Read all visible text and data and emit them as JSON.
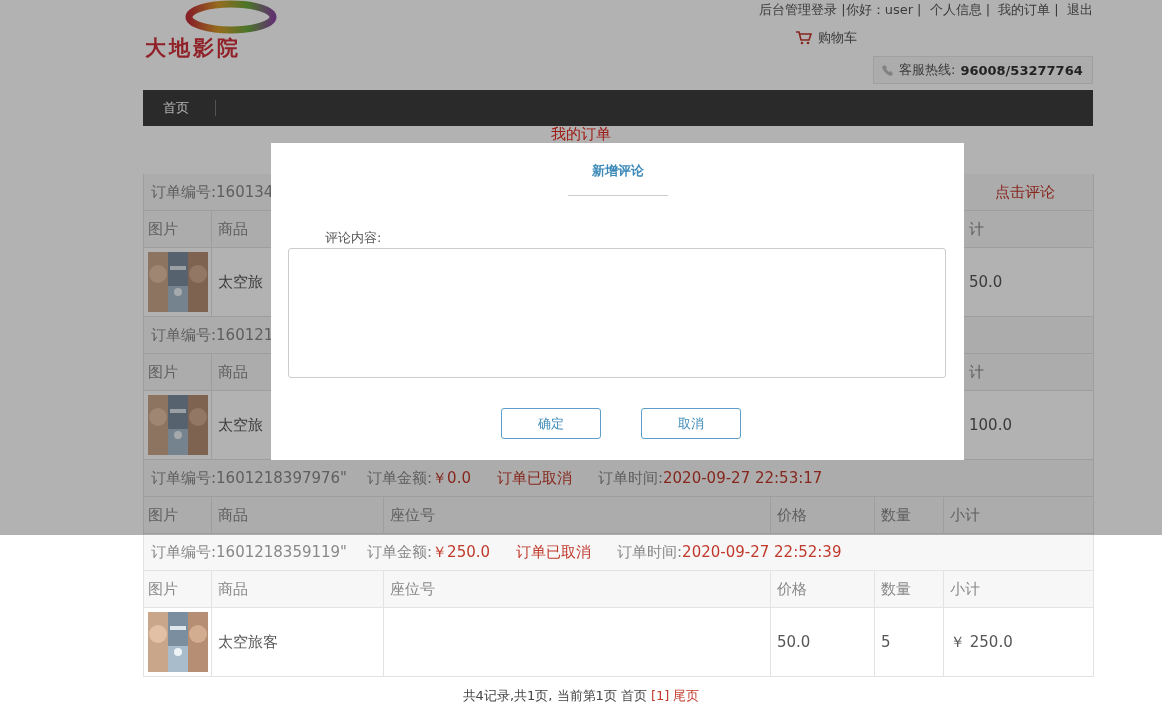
{
  "header": {
    "logo_text": "大地影院",
    "top_links": [
      "后台管理登录",
      "|你好：user",
      "|  个人信息",
      "|  我的订单",
      "|  退出"
    ],
    "cart": "购物车",
    "hotline_label": "客服热线:",
    "hotline_number": "96008/53277764"
  },
  "nav": [
    "首页"
  ],
  "page_title": "我的订单",
  "orders": [
    {
      "header": [
        {
          "kind": "text",
          "text": "订单编号:160134"
        },
        {
          "kind": "action",
          "text": "点击评论"
        }
      ],
      "columns": [
        "图片",
        "商品",
        "计"
      ],
      "items": [
        {
          "kind": "picture",
          "name": "太空旅",
          "subtotal": "50.0"
        }
      ]
    },
    {
      "header": [
        {
          "kind": "text",
          "text": "订单编号:160121"
        }
      ],
      "columns": [
        "图片",
        "商品",
        "计"
      ],
      "items": [
        {
          "kind": "picture",
          "name": "太空旅",
          "subtotal": "100.0"
        }
      ]
    },
    {
      "header": [
        {
          "kind": "text",
          "text": "订单编号:1601218397976\""
        },
        {
          "kind": "field",
          "text": "订单金额:"
        },
        {
          "kind": "value",
          "text": "￥0.0"
        },
        {
          "kind": "value",
          "text": "订单已取消"
        },
        {
          "kind": "field",
          "text": "订单时间:"
        },
        {
          "kind": "value",
          "text": "2020-09-27 22:53:17"
        }
      ],
      "columns": [
        "图片",
        "商品",
        "座位号",
        "价格",
        "数量",
        "小计"
      ]
    },
    {
      "header": [
        {
          "kind": "text",
          "text": "订单编号:1601218359119\""
        },
        {
          "kind": "field",
          "text": "订单金额:"
        },
        {
          "kind": "value",
          "text": "￥250.0"
        },
        {
          "kind": "value",
          "text": "订单已取消"
        },
        {
          "kind": "field",
          "text": "订单时间:"
        },
        {
          "kind": "value",
          "text": "2020-09-27 22:52:39"
        }
      ],
      "columns": [
        "图片",
        "商品",
        "座位号",
        "价格",
        "数量",
        "小计"
      ],
      "items": [
        {
          "kind": "picture",
          "name": "太空旅客",
          "price": "50.0",
          "qty": "5",
          "subtotal": "￥ 250.0"
        }
      ]
    }
  ],
  "pagination": {
    "summary": "共4记录,共1页, 当前第1页 首页",
    "current": "[1]",
    "last": "尾页"
  },
  "dialog": {
    "title": "新增评论",
    "label": "评论内容:",
    "buttons": [
      "确定",
      "取消"
    ]
  }
}
